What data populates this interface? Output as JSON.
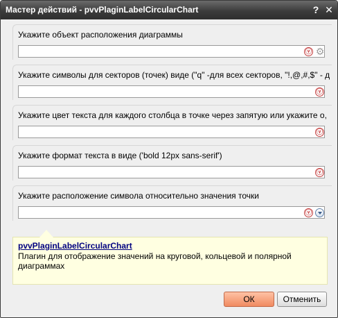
{
  "dialog": {
    "title": "Мастер действий - pvvPlaginLabelCircularChart",
    "help_label": "?",
    "close_label": "✕"
  },
  "fields": [
    {
      "label": "Укажите объект расположения диаграммы",
      "value": "",
      "icons": [
        "validate-icon",
        "gear-icon"
      ]
    },
    {
      "label": "Укажите символы для секторов (точек) виде (\"q\" -для всех секторов,  \"!,@,#,$\" - д",
      "value": "",
      "icons": [
        "validate-icon"
      ]
    },
    {
      "label": "Укажите цвет текста для каждого столбца в точке через запятую или укажите о,",
      "value": "",
      "icons": [
        "validate-icon"
      ]
    },
    {
      "label": "Укажите формат текста в виде ('bold 12px sans-serif')",
      "value": "",
      "icons": [
        "validate-icon"
      ]
    },
    {
      "label": "Укажите расположение символа относительно значения точки",
      "value": "",
      "icons": [
        "validate-icon",
        "dropdown-icon"
      ]
    }
  ],
  "info": {
    "title": "pvvPlaginLabelCircularChart",
    "description": "Плагин для отображение значений на круговой, кольцевой  и полярной диаграммах"
  },
  "buttons": {
    "ok": "ОК",
    "cancel": "Отменить"
  },
  "icons": {
    "validate": "ⓥ",
    "gear": "⚙"
  },
  "colors": {
    "titlebar": "#3c3c3c",
    "ok_button": "#f08a60",
    "info_background": "#ffffe1"
  }
}
